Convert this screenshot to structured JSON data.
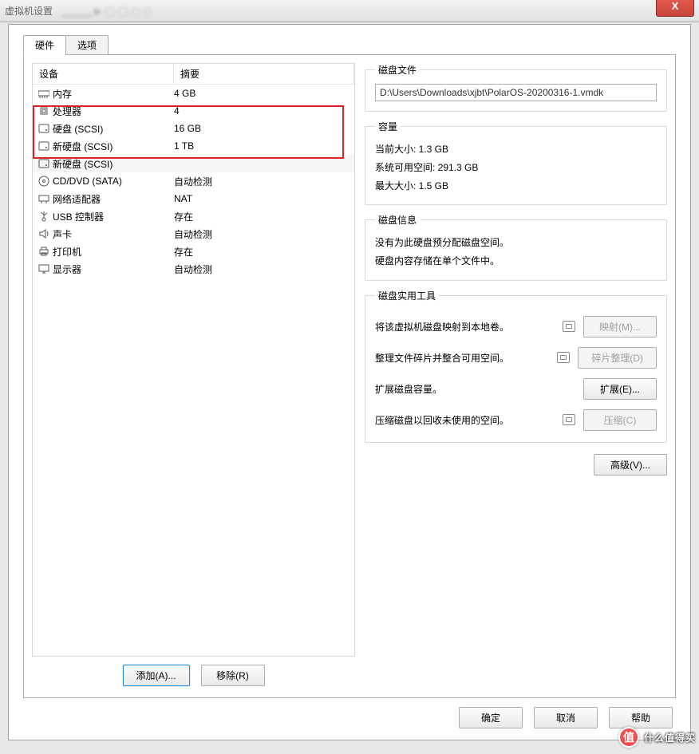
{
  "window": {
    "title": "虚拟机设置",
    "close_x": "X"
  },
  "tabs": {
    "hardware": "硬件",
    "options": "选项"
  },
  "headers": {
    "device": "设备",
    "summary": "摘要"
  },
  "devices": [
    {
      "icon": "memory-icon",
      "name": "内存",
      "summary": "4 GB",
      "highlight": false
    },
    {
      "icon": "cpu-icon",
      "name": "处理器",
      "summary": "4",
      "highlight": false
    },
    {
      "icon": "disk-icon",
      "name": "硬盘 (SCSI)",
      "summary": "16 GB",
      "highlight": true
    },
    {
      "icon": "disk-icon",
      "name": "新硬盘 (SCSI)",
      "summary": "1 TB",
      "highlight": true
    },
    {
      "icon": "disk-icon",
      "name": "新硬盘 (SCSI)",
      "summary": "",
      "highlight": true
    },
    {
      "icon": "cd-icon",
      "name": "CD/DVD (SATA)",
      "summary": "自动检测",
      "highlight": false
    },
    {
      "icon": "nic-icon",
      "name": "网络适配器",
      "summary": "NAT",
      "highlight": false
    },
    {
      "icon": "usb-icon",
      "name": "USB 控制器",
      "summary": "存在",
      "highlight": false
    },
    {
      "icon": "sound-icon",
      "name": "声卡",
      "summary": "自动检测",
      "highlight": false
    },
    {
      "icon": "printer-icon",
      "name": "打印机",
      "summary": "存在",
      "highlight": false
    },
    {
      "icon": "display-icon",
      "name": "显示器",
      "summary": "自动检测",
      "highlight": false
    }
  ],
  "left_buttons": {
    "add": "添加(A)...",
    "remove": "移除(R)"
  },
  "disk_file": {
    "legend": "磁盘文件",
    "path": "D:\\Users\\Downloads\\xjbt\\PolarOS-20200316-1.vmdk"
  },
  "capacity": {
    "legend": "容量",
    "current_size": "当前大小: 1.3 GB",
    "free_space": "系统可用空间: 291.3 GB",
    "max_size": "最大大小: 1.5 GB"
  },
  "disk_info": {
    "legend": "磁盘信息",
    "line1": "没有为此硬盘预分配磁盘空间。",
    "line2": "硬盘内容存储在单个文件中。"
  },
  "utilities": {
    "legend": "磁盘实用工具",
    "map_desc": "将该虚拟机磁盘映射到本地卷。",
    "map_btn": "映射(M)...",
    "defrag_desc": "整理文件碎片并整合可用空间。",
    "defrag_btn": "碎片整理(D)",
    "expand_desc": "扩展磁盘容量。",
    "expand_btn": "扩展(E)...",
    "compact_desc": "压缩磁盘以回收未使用的空间。",
    "compact_btn": "压缩(C)"
  },
  "advanced_btn": "高级(V)...",
  "footer": {
    "ok": "确定",
    "cancel": "取消",
    "help": "帮助"
  },
  "watermark": "什么值得买"
}
